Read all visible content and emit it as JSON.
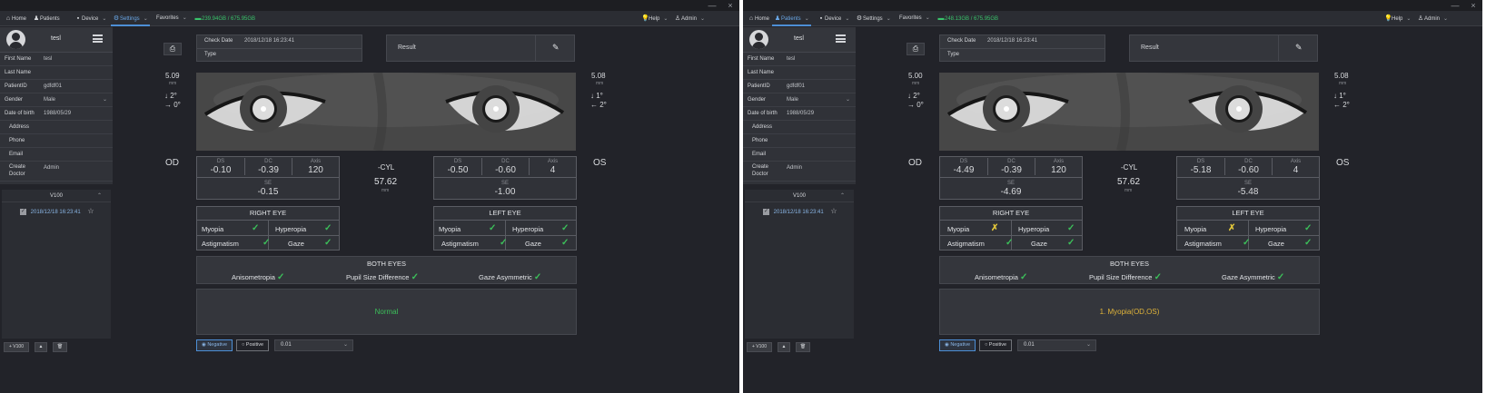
{
  "window": {
    "minimize": "—",
    "close": "×"
  },
  "nav": {
    "home": "Home",
    "patients": "Patients",
    "device": "Device",
    "settings": "Settings",
    "favorites": "Favorites",
    "help": "Help",
    "admin": "Admin"
  },
  "left": {
    "storage": "239.94GB / 675.95GB",
    "sidebar": {
      "name": "tesl",
      "fields": [
        {
          "label": "First Name",
          "value": "tesl"
        },
        {
          "label": "Last Name",
          "value": ""
        },
        {
          "label": "PatientID",
          "value": "gdfdf01"
        },
        {
          "label": "Gender",
          "value": "Male"
        },
        {
          "label": "Date of birth",
          "value": "1988/05/29"
        },
        {
          "label": "Address",
          "value": ""
        },
        {
          "label": "Phone",
          "value": ""
        },
        {
          "label": "Email",
          "value": ""
        },
        {
          "label": "Create Doctor",
          "value": "Admin"
        }
      ]
    },
    "history": {
      "header": "V100",
      "item": "2018/12/18 16:23:41"
    },
    "buttons": {
      "add": "+ V100",
      "up": "▲",
      "delete": "🗑"
    },
    "exam": {
      "check_date_label": "Check Date",
      "check_date": "2018/12/18 16:23:41",
      "type_label": "Type",
      "result_label": "Result"
    },
    "od": {
      "pupil": "5.09",
      "unit": "mm",
      "gaze1": "2°",
      "gaze2": "0°",
      "label": "OD"
    },
    "os": {
      "pupil": "5.08",
      "unit": "mm",
      "gaze1": "1°",
      "gaze2": "2°",
      "label": "OS"
    },
    "right_table": {
      "ds_h": "DS",
      "ds": "-0.10",
      "dc_h": "DC",
      "dc": "-0.39",
      "axis_h": "Axis",
      "axis": "120",
      "se_h": "SE",
      "se": "-0.15"
    },
    "left_table": {
      "ds_h": "DS",
      "ds": "-0.50",
      "dc_h": "DC",
      "dc": "-0.60",
      "axis_h": "Axis",
      "axis": "4",
      "se_h": "SE",
      "se": "-1.00"
    },
    "center": {
      "cyl": "-CYL",
      "pd": "57.62",
      "unit": "mm"
    },
    "right_eye": {
      "title": "RIGHT EYE",
      "myopia": "Myopia",
      "hyperopia": "Hyperopia",
      "astigmatism": "Astigmatism",
      "gaze": "Gaze"
    },
    "left_eye": {
      "title": "LEFT EYE",
      "myopia": "Myopia",
      "hyperopia": "Hyperopia",
      "astigmatism": "Astigmatism",
      "gaze": "Gaze"
    },
    "both_eyes": {
      "title": "BOTH EYES",
      "aniso": "Anisometropia",
      "pupil_diff": "Pupil Size Difference",
      "gaze_asym": "Gaze Asymmetric"
    },
    "result_text": "Normal",
    "result_color": "#3cbf5a",
    "bottom": {
      "negative": "Negative",
      "positive": "Positive",
      "select": "0.01"
    }
  },
  "right": {
    "storage": "248.13GB / 675.95GB",
    "sidebar": {
      "name": "tesl",
      "fields": [
        {
          "label": "First Name",
          "value": "tesl"
        },
        {
          "label": "Last Name",
          "value": ""
        },
        {
          "label": "PatientID",
          "value": "gdfdf01"
        },
        {
          "label": "Gender",
          "value": "Male"
        },
        {
          "label": "Date of birth",
          "value": "1988/05/29"
        },
        {
          "label": "Address",
          "value": ""
        },
        {
          "label": "Phone",
          "value": ""
        },
        {
          "label": "Email",
          "value": ""
        },
        {
          "label": "Create Doctor",
          "value": "Admin"
        }
      ]
    },
    "history": {
      "header": "V100",
      "item": "2018/12/18 16:23:41"
    },
    "buttons": {
      "add": "+ V100",
      "up": "▲",
      "delete": "🗑"
    },
    "exam": {
      "check_date_label": "Check Date",
      "check_date": "2018/12/18 16:23:41",
      "type_label": "Type",
      "result_label": "Result"
    },
    "od": {
      "pupil": "5.00",
      "unit": "mm",
      "gaze1": "2°",
      "gaze2": "0°",
      "label": "OD"
    },
    "os": {
      "pupil": "5.08",
      "unit": "mm",
      "gaze1": "1°",
      "gaze2": "2°",
      "label": "OS"
    },
    "right_table": {
      "ds_h": "DS",
      "ds": "-4.49",
      "dc_h": "DC",
      "dc": "-0.39",
      "axis_h": "Axis",
      "axis": "120",
      "se_h": "SE",
      "se": "-4.69"
    },
    "left_table": {
      "ds_h": "DS",
      "ds": "-5.18",
      "dc_h": "DC",
      "dc": "-0.60",
      "axis_h": "Axis",
      "axis": "4",
      "se_h": "SE",
      "se": "-5.48"
    },
    "center": {
      "cyl": "-CYL",
      "pd": "57.62",
      "unit": "mm"
    },
    "right_eye": {
      "title": "RIGHT EYE",
      "myopia": "Myopia",
      "hyperopia": "Hyperopia",
      "astigmatism": "Astigmatism",
      "gaze": "Gaze"
    },
    "left_eye": {
      "title": "LEFT EYE",
      "myopia": "Myopia",
      "hyperopia": "Hyperopia",
      "astigmatism": "Astigmatism",
      "gaze": "Gaze"
    },
    "both_eyes": {
      "title": "BOTH EYES",
      "aniso": "Anisometropia",
      "pupil_diff": "Pupil Size Difference",
      "gaze_asym": "Gaze Asymmetric"
    },
    "result_text": "1. Myopia(OD,OS)",
    "result_color": "#e0b43a",
    "bottom": {
      "negative": "Negative",
      "positive": "Positive",
      "select": "0.01"
    }
  },
  "icons": {
    "check": "✓",
    "cross": "✗",
    "checkbox": "✓",
    "pencil": "✎",
    "print": "⎙",
    "arrow_down": "↓",
    "arrow_right": "→",
    "arrow_left": "←",
    "star": "☆",
    "chevron": "⌄"
  }
}
